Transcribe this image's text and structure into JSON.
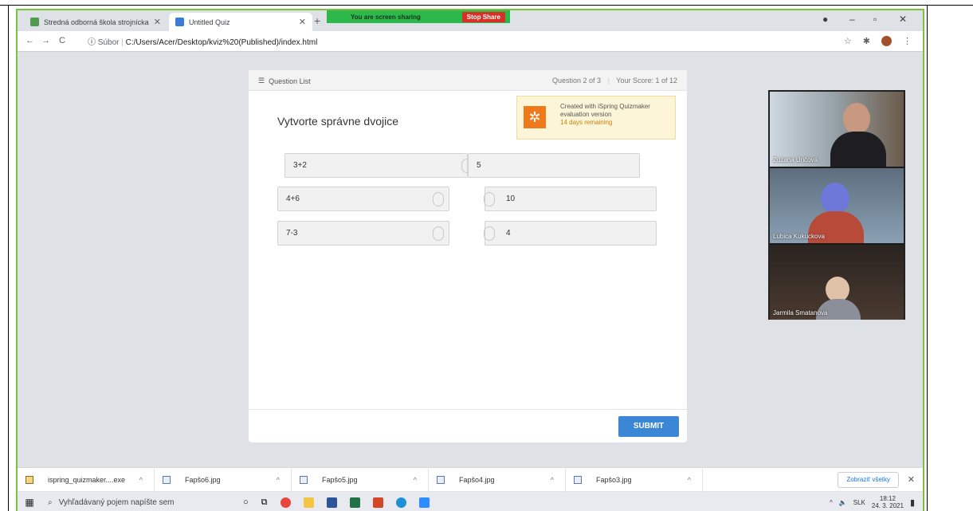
{
  "browser": {
    "tabs": [
      {
        "label": "Stredná odborná škola strojnícka",
        "close": "✕"
      },
      {
        "label": "Untitled Quiz",
        "close": "✕"
      }
    ],
    "new_tab": "+",
    "share_text": "You are screen sharing",
    "stop_share": "Stop Share",
    "address_scheme": "Súbor",
    "address_url": "C:/Users/Acer/Desktop/kviz%20(Published)/index.html"
  },
  "quiz": {
    "question_list_label": "Question List",
    "question_progress": "Question 2 of 3",
    "score": "Your Score: 1 of 12",
    "title": "Vytvorte správne dvojice",
    "promo": {
      "line1": "Created with iSpring Quizmaker",
      "line2": "evaluation version",
      "line3": "14 days remaining"
    },
    "pairs": [
      {
        "left": "3+2",
        "right": "5"
      },
      {
        "left": "4+6",
        "right": "10"
      },
      {
        "left": "7-3",
        "right": "4"
      }
    ],
    "submit_label": "SUBMIT"
  },
  "participants": [
    {
      "name": "Zuzana Uričová"
    },
    {
      "name": "Lubica Kukuckova"
    },
    {
      "name": "Jarmila Smatanova"
    }
  ],
  "downloads": [
    {
      "name": "ispring_quizmaker....exe"
    },
    {
      "name": "Fapšo6.jpg"
    },
    {
      "name": "Fapšo5.jpg"
    },
    {
      "name": "Fapšo4.jpg"
    },
    {
      "name": "Fapšo3.jpg"
    }
  ],
  "show_all_label": "Zobraziť všetky",
  "taskbar": {
    "search_placeholder": "Vyhľadávaný pojem napíšte sem",
    "lang": "SLK",
    "time": "18:12",
    "date": "24. 3. 2021"
  },
  "colors": {
    "share_green": "#2db84c",
    "submit_blue": "#3c86d6",
    "ispring_orange": "#f07a1a"
  }
}
